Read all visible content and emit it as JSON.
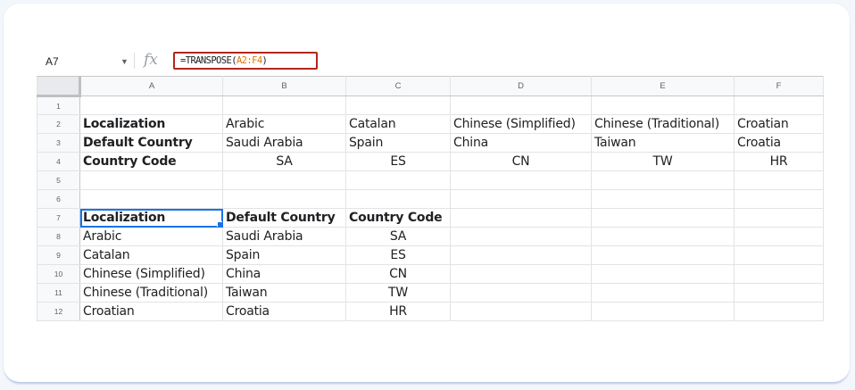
{
  "formula_bar": {
    "cell_ref": "A7",
    "formula_prefix": "=TRANSPOSE(",
    "formula_range": "A2:F4",
    "formula_suffix": ")",
    "fx_label": "fx"
  },
  "columns": [
    "A",
    "B",
    "C",
    "D",
    "E",
    "F"
  ],
  "rows": [
    {
      "num": "1",
      "cells": [
        "",
        "",
        "",
        "",
        "",
        ""
      ]
    },
    {
      "num": "2",
      "cells": [
        "Localization",
        "Arabic",
        "Catalan",
        "Chinese (Simplified)",
        "Chinese (Traditional)",
        "Croatian"
      ]
    },
    {
      "num": "3",
      "cells": [
        "Default Country",
        "Saudi Arabia",
        "Spain",
        "China",
        "Taiwan",
        "Croatia"
      ]
    },
    {
      "num": "4",
      "cells": [
        "Country Code",
        "SA",
        "ES",
        "CN",
        "TW",
        "HR"
      ]
    },
    {
      "num": "5",
      "cells": [
        "",
        "",
        "",
        "",
        "",
        ""
      ]
    },
    {
      "num": "6",
      "cells": [
        "",
        "",
        "",
        "",
        "",
        ""
      ]
    },
    {
      "num": "7",
      "cells": [
        "Localization",
        "Default Country",
        "Country Code",
        "",
        "",
        ""
      ]
    },
    {
      "num": "8",
      "cells": [
        "Arabic",
        "Saudi Arabia",
        "SA",
        "",
        "",
        ""
      ]
    },
    {
      "num": "9",
      "cells": [
        "Catalan",
        "Spain",
        "ES",
        "",
        "",
        ""
      ]
    },
    {
      "num": "10",
      "cells": [
        "Chinese (Simplified)",
        "China",
        "CN",
        "",
        "",
        ""
      ]
    },
    {
      "num": "11",
      "cells": [
        "Chinese (Traditional)",
        "Taiwan",
        "TW",
        "",
        "",
        ""
      ]
    },
    {
      "num": "12",
      "cells": [
        "Croatian",
        "Croatia",
        "HR",
        "",
        "",
        ""
      ]
    }
  ],
  "selected_cell": "A7"
}
